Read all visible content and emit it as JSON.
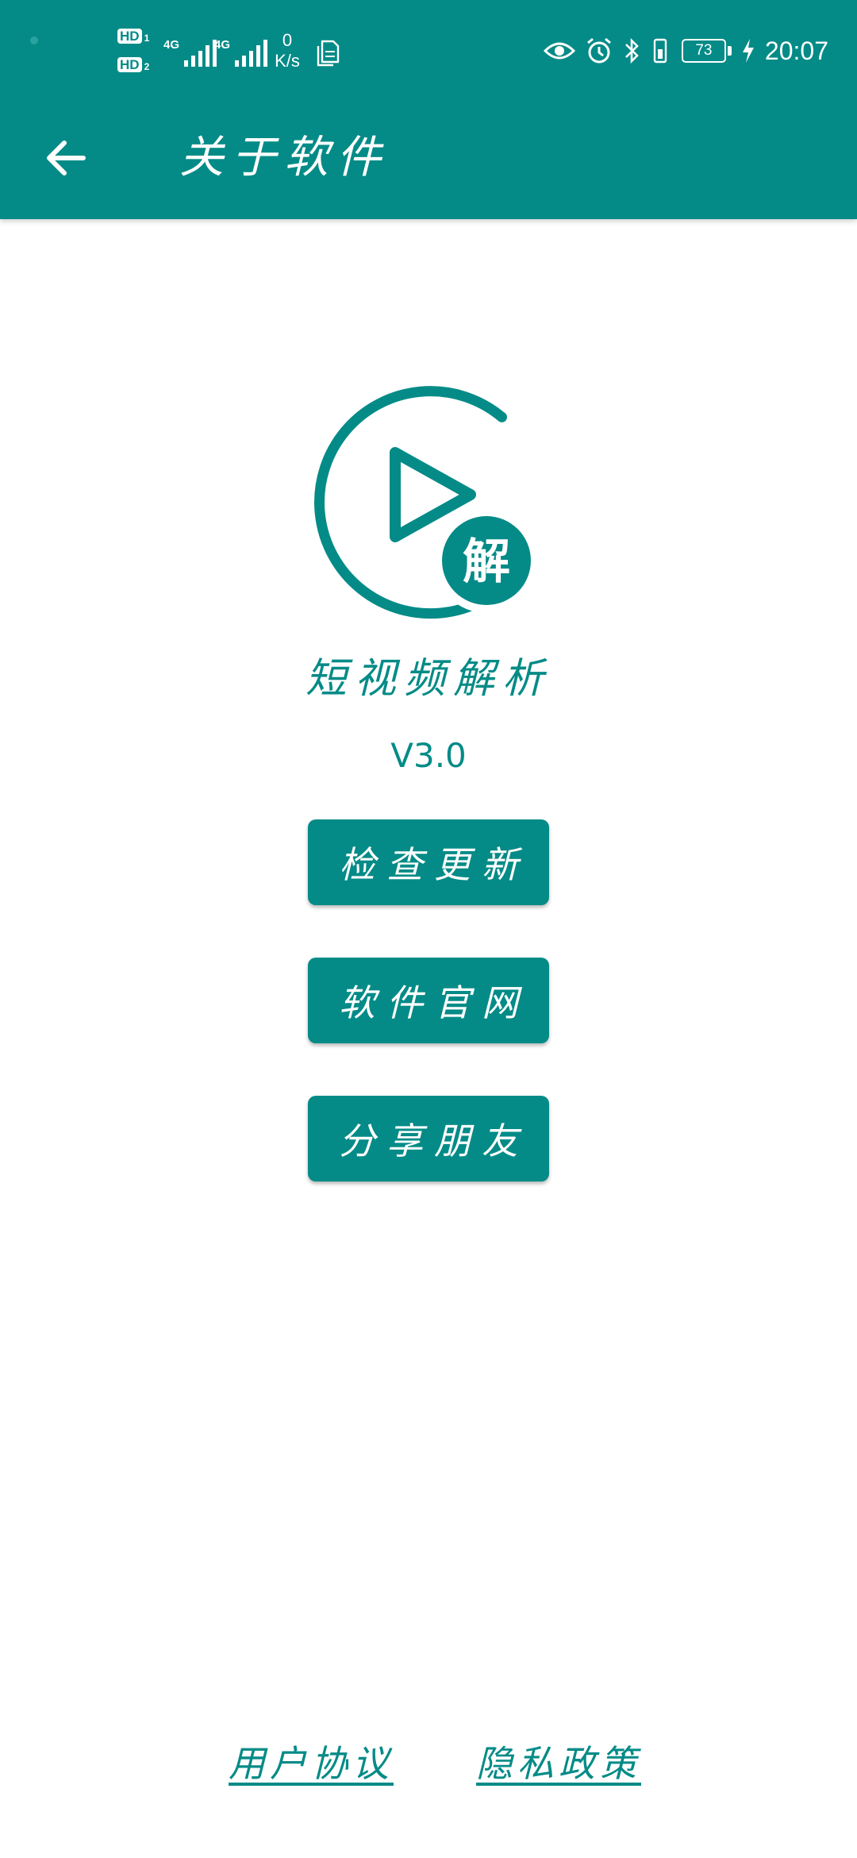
{
  "status_bar": {
    "sim1_label": "HD",
    "sim1_slot": "1",
    "sim2_label": "HD",
    "sim2_slot": "2",
    "network1": "4G",
    "network2": "4G",
    "net_speed_value": "0",
    "net_speed_unit": "K/s",
    "battery_level": "73",
    "time": "20:07",
    "icons": [
      "eye-comfort-icon",
      "alarm-icon",
      "bluetooth-icon",
      "vibrate-icon",
      "battery-icon",
      "charging-icon"
    ]
  },
  "app_bar": {
    "title": "关于软件",
    "back_icon": "arrow-left-icon"
  },
  "app_info": {
    "logo_icon": "play-parse-logo-icon",
    "logo_badge_text": "解",
    "name": "短视频解析",
    "version": "V3.0"
  },
  "actions": {
    "check_update": "检查更新",
    "official_site": "软件官网",
    "share_friends": "分享朋友"
  },
  "footer": {
    "user_agreement": "用户协议",
    "privacy_policy": "隐私政策"
  },
  "colors": {
    "primary": "#048b87",
    "background": "#ffffff",
    "on_primary": "#ffffff"
  }
}
